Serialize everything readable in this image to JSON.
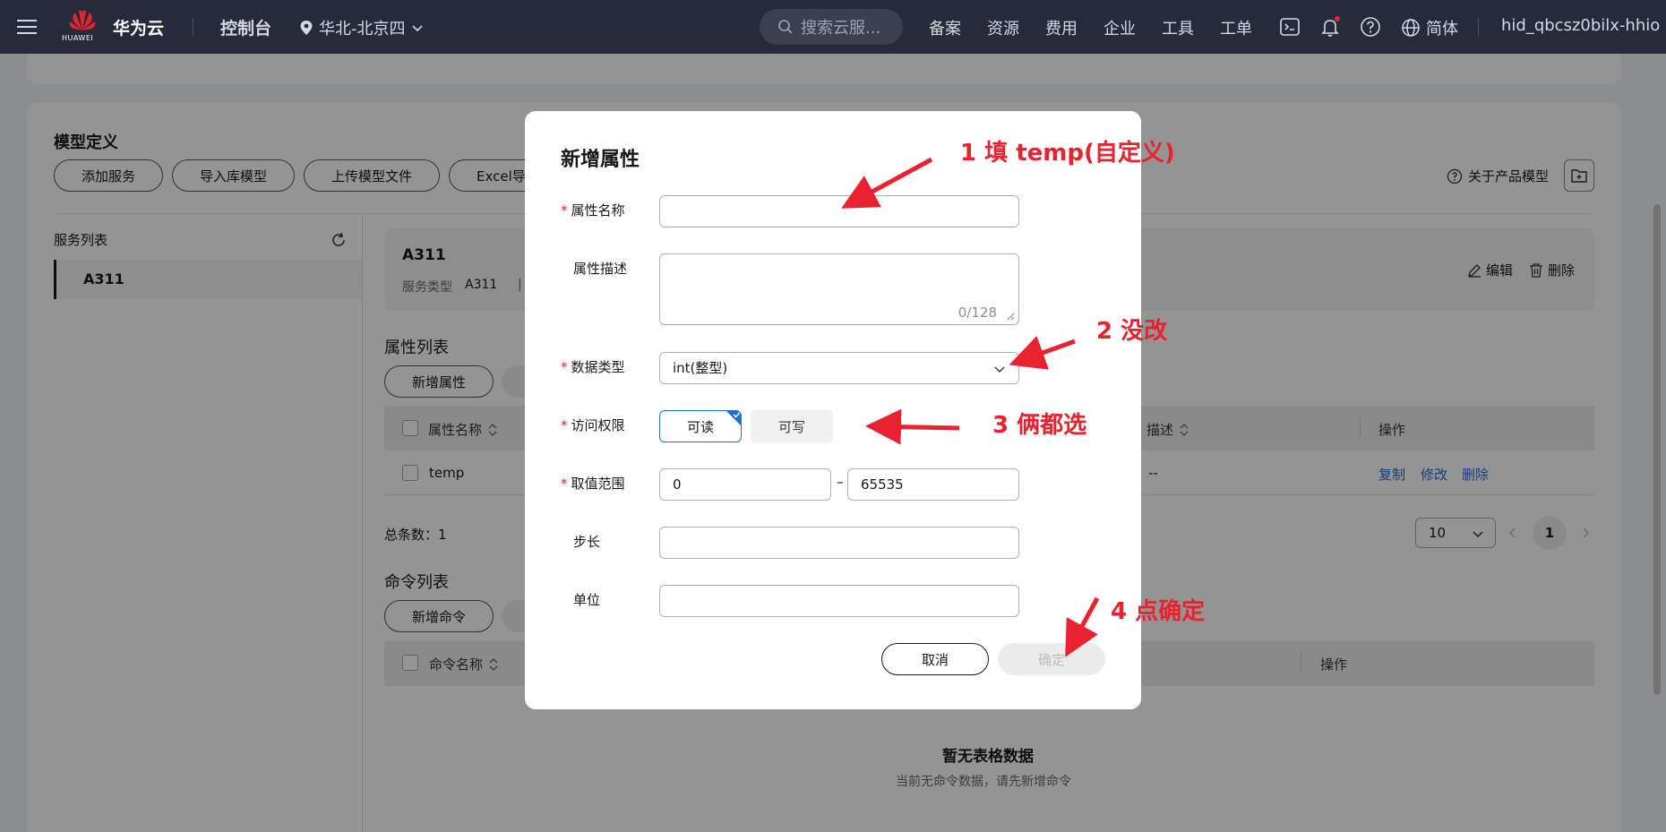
{
  "topbar": {
    "logo_text": "HUAWEI",
    "brand": "华为云",
    "console": "控制台",
    "region": "华北-北京四",
    "search_placeholder": "搜索云服...",
    "nav": [
      "备案",
      "资源",
      "费用",
      "企业",
      "工具",
      "工单"
    ],
    "language": "简体",
    "username": "hid_qbcsz0bilx-hhio"
  },
  "page": {
    "section_title": "模型定义",
    "toolbar": [
      "添加服务",
      "导入库模型",
      "上传模型文件",
      "Excel导"
    ],
    "about_product_model": "关于产品模型",
    "service_list_title": "服务列表",
    "active_service": "A311",
    "service_card": {
      "name": "A311",
      "type_label": "服务类型",
      "type_value": "A311",
      "separator": "|",
      "edit": "编辑",
      "delete": "删除"
    },
    "attr_list_title": "属性列表",
    "add_attr_button": "新增属性",
    "attr_table": {
      "headers": [
        "属性名称",
        "描述",
        "操作"
      ],
      "rows": [
        {
          "name": "temp",
          "desc": "--",
          "actions": [
            "复制",
            "修改",
            "删除"
          ]
        }
      ]
    },
    "total_label": "总条数：1",
    "page_size": "10",
    "current_page": "1",
    "cmd_list_title": "命令列表",
    "add_cmd_button": "新增命令",
    "cmd_table": {
      "headers": [
        "命令名称",
        "操作"
      ]
    },
    "empty_title": "暂无表格数据",
    "empty_desc": "当前无命令数据，请先新增命令"
  },
  "modal": {
    "title": "新增属性",
    "fields": {
      "name_label": "属性名称",
      "name_value": "",
      "desc_label": "属性描述",
      "desc_counter": "0/128",
      "type_label": "数据类型",
      "type_value": "int(整型)",
      "access_label": "访问权限",
      "access_read": "可读",
      "access_write": "可写",
      "range_label": "取值范围",
      "range_min": "0",
      "range_dash": "–",
      "range_max": "65535",
      "step_label": "步长",
      "step_value": "",
      "unit_label": "单位",
      "unit_value": ""
    },
    "cancel": "取消",
    "confirm": "确定"
  },
  "annotations": {
    "a1": "1 填 temp(自定义)",
    "a2": "2 没改",
    "a3": "3 俩都选",
    "a4": "4 点确定"
  },
  "colors": {
    "topbar_bg": "#252b3a",
    "annotation_red": "#e8232f",
    "link_blue": "#1f6fd1",
    "selected_border": "#1f6fd1"
  }
}
